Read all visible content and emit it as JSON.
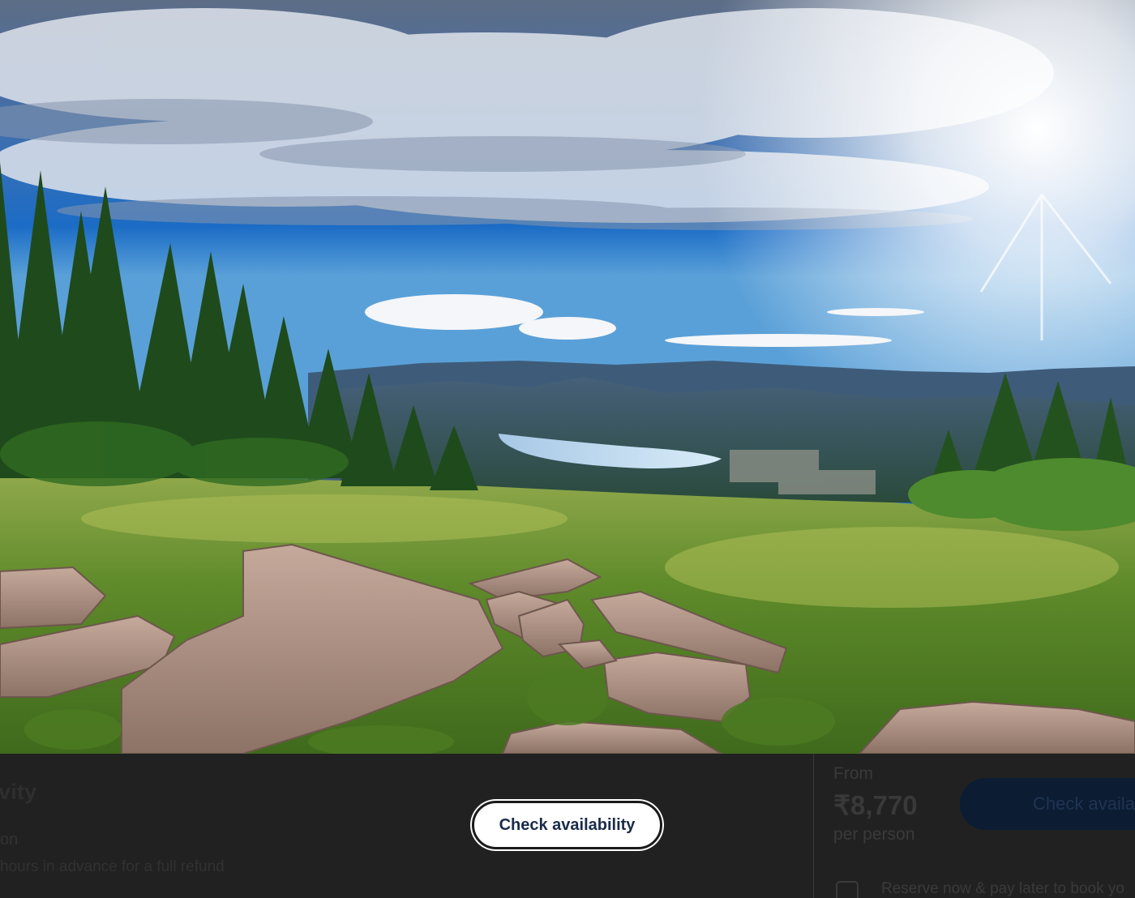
{
  "gallery": {
    "image_alt": "Black Forest landscape with lake, mountains, fir trees, meadow and rocks"
  },
  "activity": {
    "title_fragment": "vity",
    "line1_fragment": "on",
    "line2_fragment": "hours in advance for a full refund"
  },
  "booking": {
    "from_label": "From",
    "price": "₹8,770",
    "per_person": "per person",
    "cta_label": "Check availa",
    "reserve_text": "Reserve now & pay later to book yo"
  },
  "overlay_button": {
    "label": "Check availability"
  },
  "colors": {
    "strip_bg": "#212121",
    "cta_dim": "#0b1c33",
    "button_bg": "#ffffff",
    "button_text": "#1a2b49"
  }
}
